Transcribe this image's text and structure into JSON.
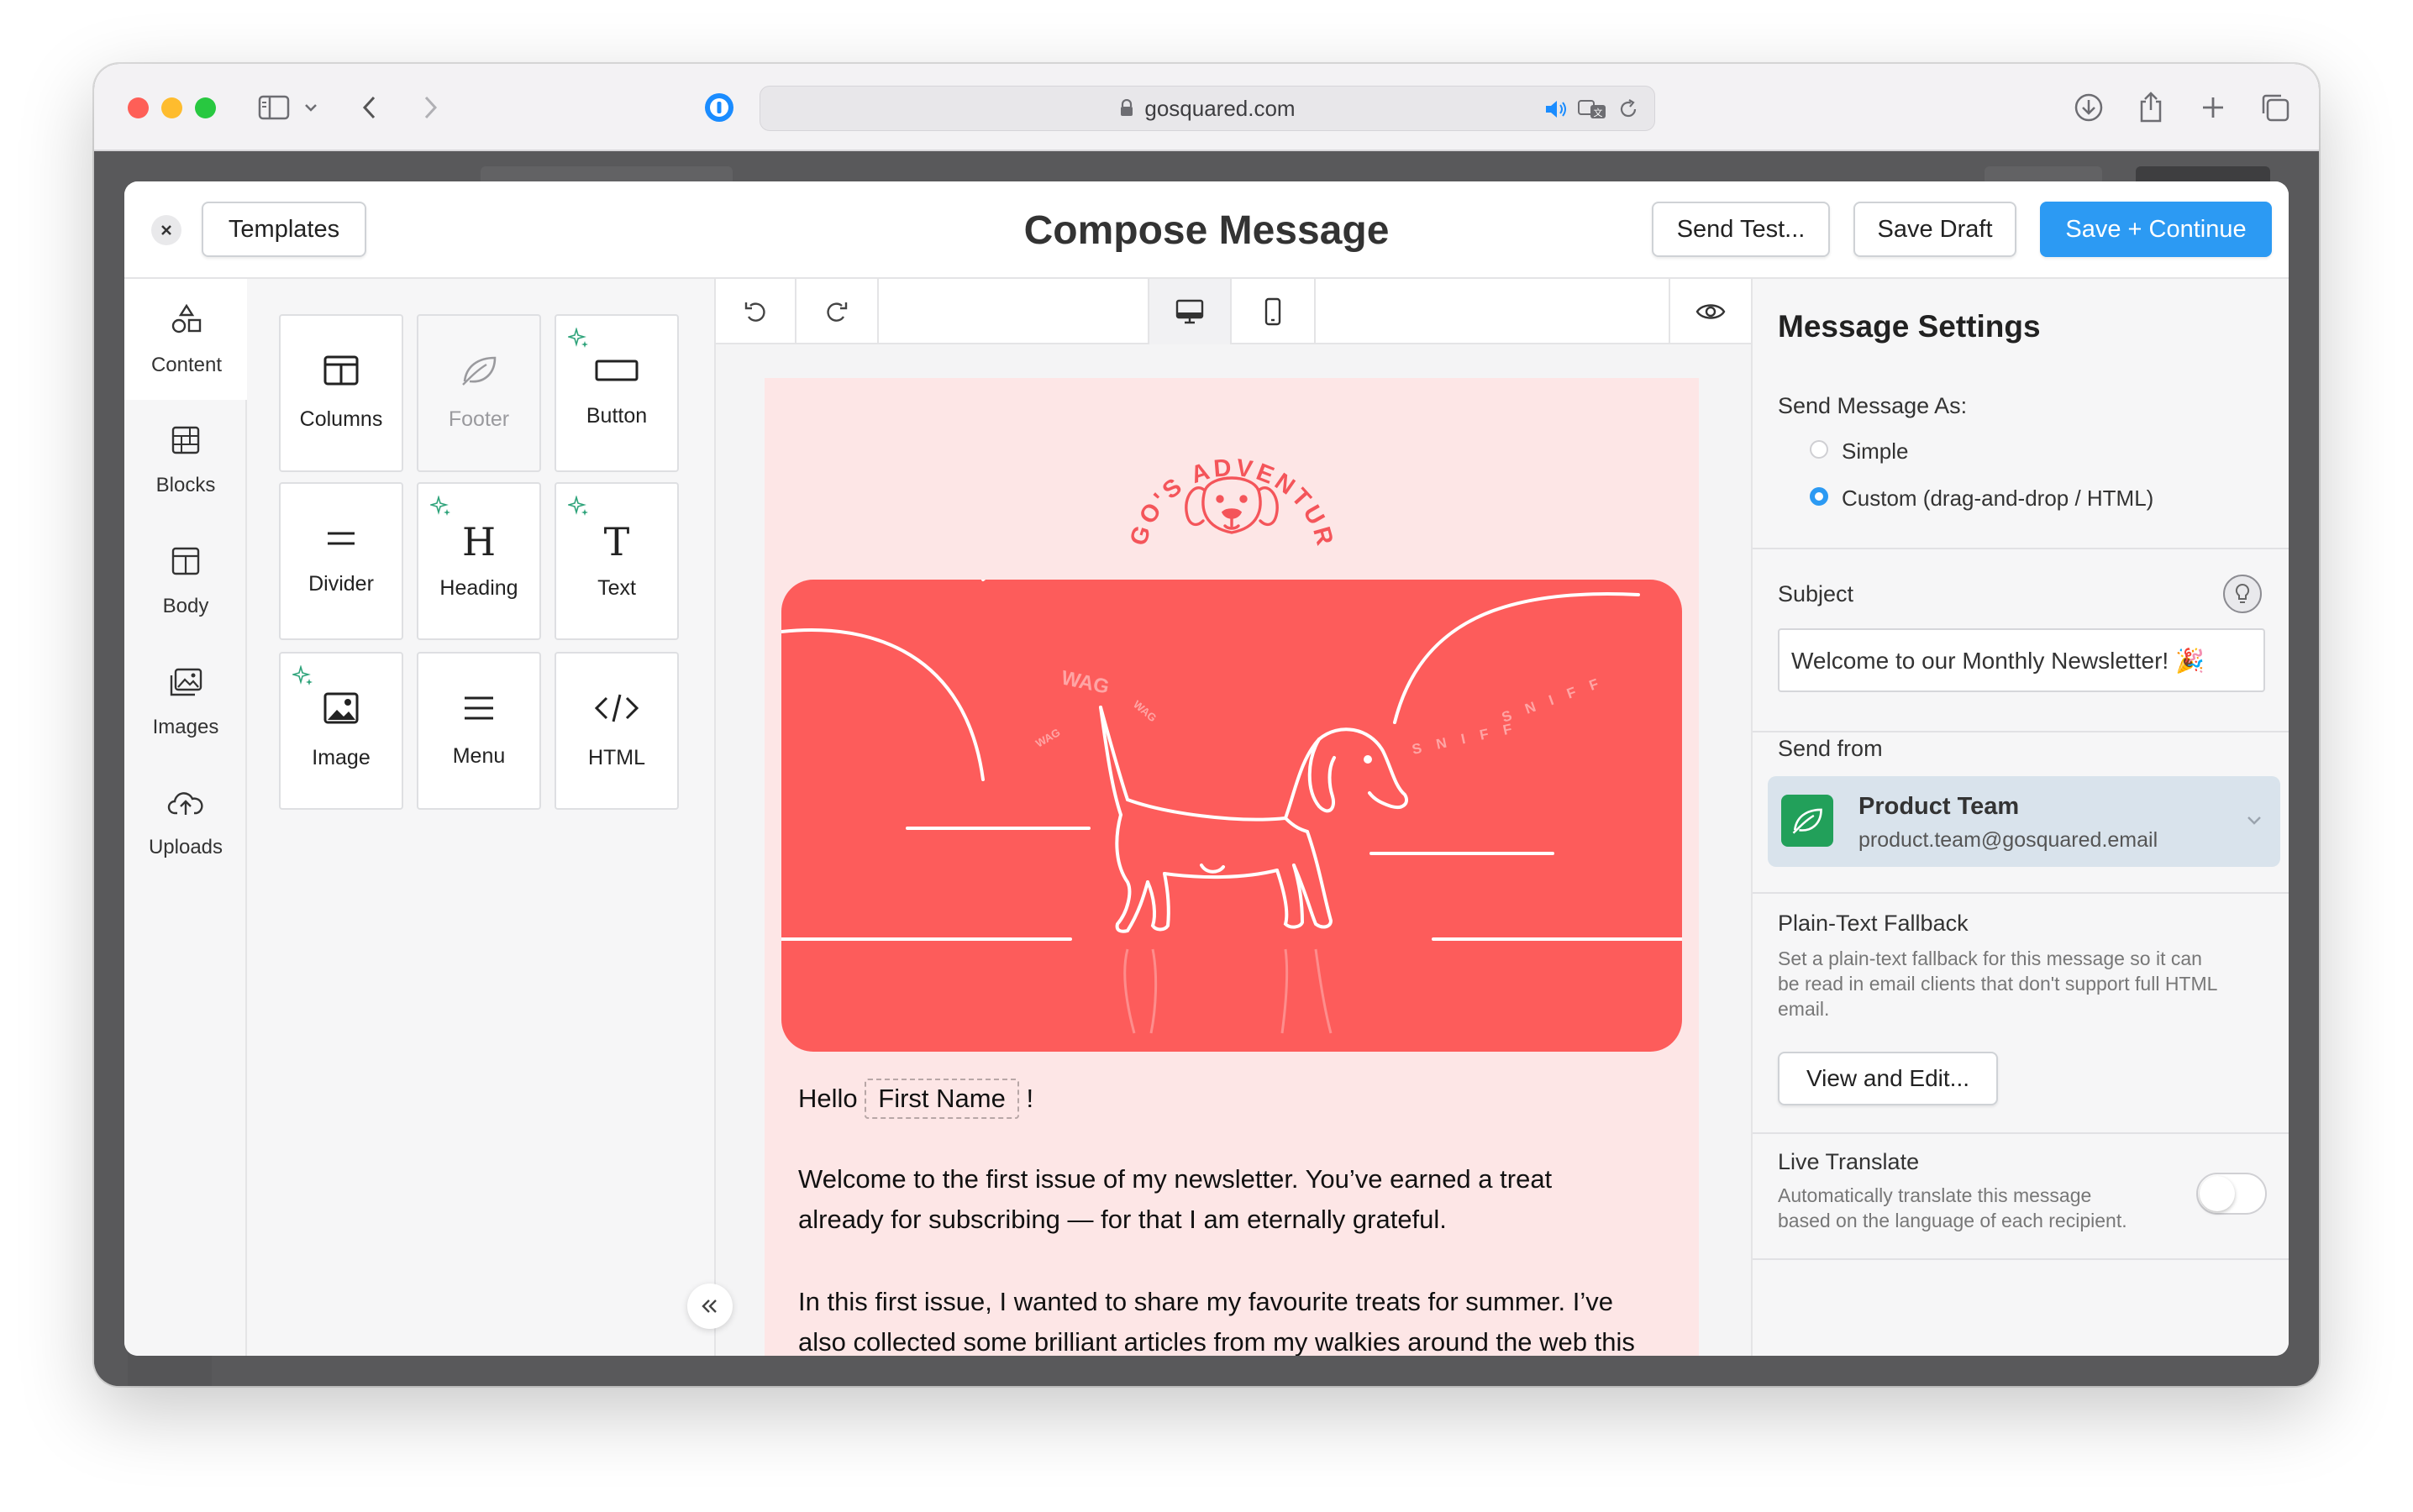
{
  "browser": {
    "url": "gosquared.com"
  },
  "header": {
    "title": "Compose Message",
    "templates_label": "Templates",
    "send_test_label": "Send Test...",
    "save_draft_label": "Save Draft",
    "save_continue_label": "Save + Continue"
  },
  "leftnav": {
    "items": [
      {
        "label": "Content",
        "icon": "shapes-icon",
        "active": true
      },
      {
        "label": "Blocks",
        "icon": "blocks-icon"
      },
      {
        "label": "Body",
        "icon": "body-layout-icon"
      },
      {
        "label": "Images",
        "icon": "images-icon"
      },
      {
        "label": "Uploads",
        "icon": "cloud-upload-icon"
      }
    ]
  },
  "palette": {
    "tiles": [
      {
        "label": "Columns",
        "icon": "columns-icon"
      },
      {
        "label": "Footer",
        "icon": "leaf-icon",
        "disabled": true
      },
      {
        "label": "Button",
        "icon": "button-icon",
        "sparkle": true
      },
      {
        "label": "Divider",
        "icon": "divider-icon"
      },
      {
        "label": "Heading",
        "icon": "heading-icon",
        "sparkle": true
      },
      {
        "label": "Text",
        "icon": "text-icon",
        "sparkle": true
      },
      {
        "label": "Image",
        "icon": "image-icon",
        "sparkle": true
      },
      {
        "label": "Menu",
        "icon": "menu-icon"
      },
      {
        "label": "HTML",
        "icon": "code-icon"
      }
    ]
  },
  "email": {
    "brand": "HUGO'S ADVENTURES",
    "hero_words": [
      "WAG",
      "WAG",
      "WAG",
      "SNIFF",
      "SNIFF"
    ],
    "greeting": "Hello",
    "merge_tag": "First Name",
    "greeting_end": "!",
    "para1_line1": "Welcome to the first issue of my newsletter. You’ve earned a treat",
    "para1_line2": "already for subscribing — for that I am eternally grateful.",
    "para2_line1": "In this first issue, I wanted to share my favourite treats for summer. I’ve",
    "para2_line2": "also collected some brilliant articles from my walkies around the web this"
  },
  "settings": {
    "title": "Message Settings",
    "send_as_label": "Send Message As:",
    "options": [
      {
        "label": "Simple",
        "selected": false
      },
      {
        "label": "Custom (drag-and-drop / HTML)",
        "selected": true
      }
    ],
    "subject_label": "Subject",
    "subject_value": "Welcome to our Monthly Newsletter! 🎉",
    "send_from_label": "Send from",
    "sender_name": "Product Team",
    "sender_email": "product.team@gosquared.email",
    "fallback_title": "Plain-Text Fallback",
    "fallback_desc_1": "Set a plain-text fallback for this message so it can",
    "fallback_desc_2": "be read in email clients that don't support full HTML",
    "fallback_desc_3": "email.",
    "fallback_button": "View and Edit...",
    "translate_title": "Live Translate",
    "translate_desc_1": "Automatically translate this message",
    "translate_desc_2": "based on the language of each recipient.",
    "translate_enabled": false
  },
  "colors": {
    "accent": "#2c9af3",
    "hero": "#fd5c5b",
    "email_bg": "#fde6e6",
    "sender_bg": "#d9e3ec",
    "sender_logo": "#22a05a"
  }
}
